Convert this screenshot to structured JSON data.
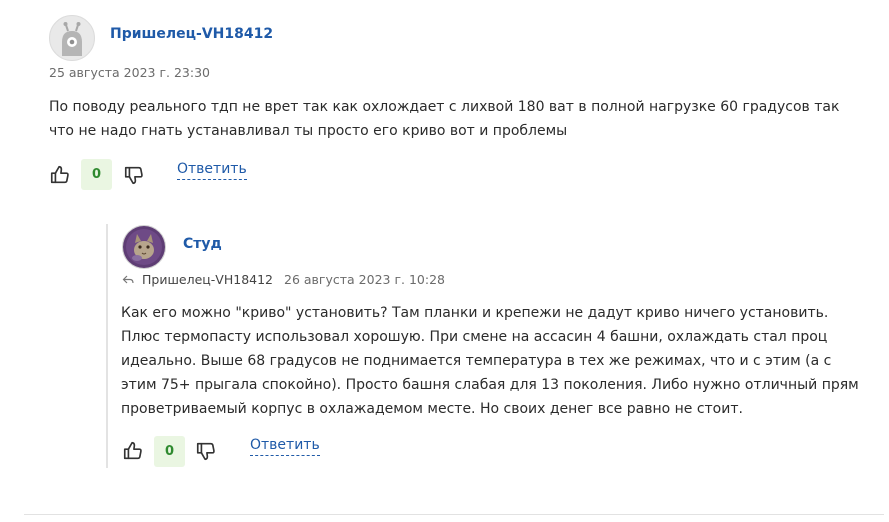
{
  "comment": {
    "author": "Пришелец-VH18412",
    "date": "25 августа 2023 г. 23:30",
    "text": "По поводу реального тдп не врет так как охлождает с лихвой 180 ват в полной нагрузке 60 градусов так что не надо гнать устанавливал ты просто его криво вот и проблемы",
    "votes": "0",
    "reply_label": "Ответить",
    "avatar_icon": "alien-icon"
  },
  "reply": {
    "author": "Студ",
    "reply_to": "Пришелец-VH18412",
    "date": "26 августа 2023 г. 10:28",
    "text": "Как его можно \"криво\" установить? Там планки и крепежи не дадут криво ничего установить. Плюс термопасту использовал хорошую. При смене на ассасин 4 башни, охлаждать стал проц идеально. Выше 68 градусов не поднимается температура в тех же режимах, что и с этим (а с этим 75+ прыгала спокойно). Просто башня слабая для 13 поколения. Либо нужно отличный прям проветриваемый корпус в охлажадемом месте. Но своих денег все равно не стоит.",
    "votes": "0",
    "reply_label": "Ответить",
    "avatar_icon": "cat-photo-avatar"
  },
  "colors": {
    "link": "#1f5aa8",
    "vote_bg": "#eaf6e2",
    "vote_text": "#2f8a2f"
  }
}
